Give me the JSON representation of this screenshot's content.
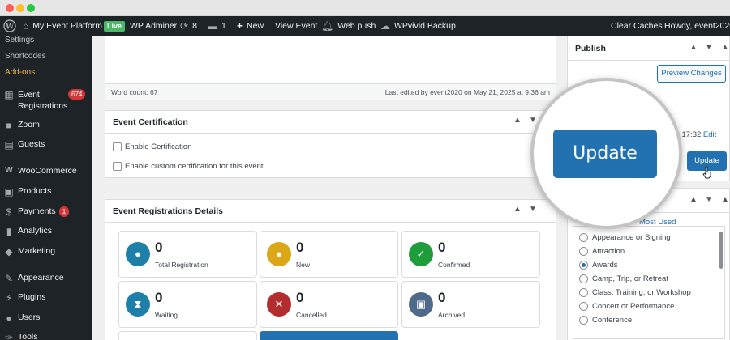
{
  "adminbar": {
    "site_name": "My Event Platform",
    "live_badge": "Live",
    "wp_adminer": "WP Adminer",
    "updates_count": "8",
    "comments_count": "1",
    "new_label": "New",
    "view_event": "View Event",
    "web_push": "Web push",
    "wpvivid": "WPvivid Backup",
    "clear_caches": "Clear Caches",
    "howdy": "Howdy, event2020"
  },
  "sidebar": {
    "sub_items": [
      "Settings",
      "Shortcodes",
      "Add-ons"
    ],
    "items": [
      {
        "label": "Event Registrations",
        "badge": "674",
        "icon": "calendar-icon"
      },
      {
        "label": "Zoom",
        "icon": "video-icon"
      },
      {
        "label": "Guests",
        "icon": "id-card-icon"
      },
      {
        "label": "WooCommerce",
        "icon": "woocommerce-icon"
      },
      {
        "label": "Products",
        "icon": "archive-icon"
      },
      {
        "label": "Payments",
        "badge": "1",
        "icon": "dollar-icon"
      },
      {
        "label": "Analytics",
        "icon": "bar-chart-icon"
      },
      {
        "label": "Marketing",
        "icon": "megaphone-icon"
      },
      {
        "label": "Appearance",
        "icon": "paintbrush-icon"
      },
      {
        "label": "Plugins",
        "icon": "plug-icon"
      },
      {
        "label": "Users",
        "icon": "user-icon"
      },
      {
        "label": "Tools",
        "icon": "wrench-icon"
      }
    ]
  },
  "editor": {
    "word_count": "Word count: 67",
    "last_edited": "Last edited by event2020 on May 21, 2025 at 9:36 am"
  },
  "certification": {
    "title": "Event Certification",
    "options": [
      "Enable Certification",
      "Enable custom certification for this event"
    ]
  },
  "registrations": {
    "title": "Event Registrations Details",
    "stats": [
      {
        "value": "0",
        "label": "Total Registration",
        "color": "#1e7fa8",
        "icon": "user-icon"
      },
      {
        "value": "0",
        "label": "New",
        "color": "#dba617",
        "icon": "user-plus-icon"
      },
      {
        "value": "0",
        "label": "Confirmed",
        "color": "#1f9d3a",
        "icon": "user-check-icon"
      },
      {
        "value": "0",
        "label": "Waiting",
        "color": "#1e7fa8",
        "icon": "hourglass-icon"
      },
      {
        "value": "0",
        "label": "Cancelled",
        "color": "#b32d2e",
        "icon": "user-x-icon"
      },
      {
        "value": "0",
        "label": "Archived",
        "color": "#4d6a8a",
        "icon": "archive-icon"
      }
    ]
  },
  "publish": {
    "title": "Publish",
    "preview_button": "Preview Changes",
    "date_partial": "5 at 17:32",
    "edit_link": "Edit",
    "update_button": "Update",
    "magnified_update": "Update"
  },
  "categories": {
    "most_used": "Most Used",
    "items": [
      {
        "label": "Appearance or Signing",
        "checked": false
      },
      {
        "label": "Attraction",
        "checked": false
      },
      {
        "label": "Awards",
        "checked": true
      },
      {
        "label": "Camp, Trip, or Retreat",
        "checked": false
      },
      {
        "label": "Class, Training, or Workshop",
        "checked": false
      },
      {
        "label": "Concert or Performance",
        "checked": false
      },
      {
        "label": "Conference",
        "checked": false
      }
    ]
  },
  "colors": {
    "admin_dark": "#1d2327",
    "primary_blue": "#2271b1",
    "badge_red": "#d63638",
    "active_orange": "#f0b849"
  }
}
